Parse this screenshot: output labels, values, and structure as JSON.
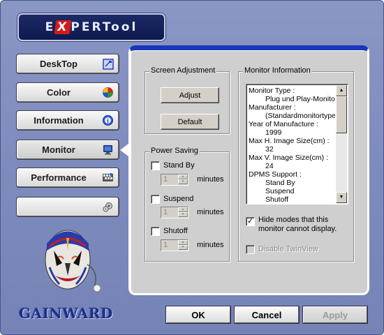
{
  "brand": {
    "logo_text_pre": "E",
    "logo_x": "X",
    "logo_text_post": "PERTool",
    "footer_logo": "GAINWARD"
  },
  "nav": [
    {
      "label": "DeskTop",
      "icon": "desktop-icon"
    },
    {
      "label": "Color",
      "icon": "color-palette-icon"
    },
    {
      "label": "Information",
      "icon": "info-icon"
    },
    {
      "label": "Monitor",
      "icon": "monitor-icon",
      "active": true
    },
    {
      "label": "Performance",
      "icon": "performance-icon"
    },
    {
      "label": "",
      "icon": "gear-icon"
    }
  ],
  "screen_adjustment": {
    "title": "Screen Adjustment",
    "adjust_label": "Adjust",
    "default_label": "Default"
  },
  "power_saving": {
    "title": "Power Saving",
    "items": [
      {
        "label": "Stand By",
        "value": "1",
        "unit": "minutes",
        "checked": false
      },
      {
        "label": "Suspend",
        "value": "1",
        "unit": "minutes",
        "checked": false
      },
      {
        "label": "Shutoff",
        "value": "1",
        "unit": "minutes",
        "checked": false
      }
    ]
  },
  "monitor_info": {
    "title": "Monitor Information",
    "lines": [
      {
        "text": "Monitor Type :",
        "indent": false
      },
      {
        "text": "Plug und Play-Monitor",
        "indent": true
      },
      {
        "text": "Manufacturer :",
        "indent": false
      },
      {
        "text": "(Standardmonitortypen)",
        "indent": true
      },
      {
        "text": "Year of Manufacture :",
        "indent": false
      },
      {
        "text": "1999",
        "indent": true
      },
      {
        "text": "Max H. Image Size(cm) :",
        "indent": false
      },
      {
        "text": "32",
        "indent": true
      },
      {
        "text": "Max V. Image Size(cm) :",
        "indent": false
      },
      {
        "text": "24",
        "indent": true
      },
      {
        "text": "DPMS Support :",
        "indent": false
      },
      {
        "text": "Stand By",
        "indent": true
      },
      {
        "text": "Suspend",
        "indent": true
      },
      {
        "text": "Shutoff",
        "indent": true
      }
    ],
    "hide_modes_label_1": "Hide modes that this",
    "hide_modes_label_2": "monitor cannot display.",
    "hide_modes_checked": true,
    "twinview_label": "Disable TwinView",
    "twinview_checked": false
  },
  "buttons": {
    "ok": "OK",
    "cancel": "Cancel",
    "apply": "Apply"
  },
  "colors": {
    "window_bg": "#7e8bbd",
    "panel_accent": "#1a35b8",
    "panel_bg": "#cfcfcf"
  }
}
